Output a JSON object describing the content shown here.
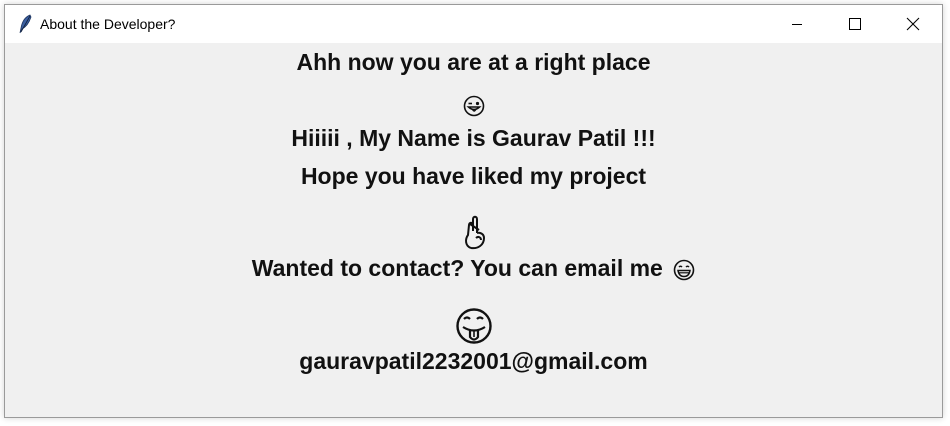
{
  "window": {
    "title": "About the Developer?",
    "controls": [
      "minimize",
      "maximize",
      "close"
    ]
  },
  "messages": {
    "line1": "Ahh now you are at a right place",
    "line2": "Hiiiii , My Name is Gaurav Patil !!!",
    "line3": "Hope you have liked my project",
    "line4": "Wanted to contact? You can email me",
    "email": "gauravpatil2232001@gmail.com"
  },
  "icons": {
    "emoji1": "tongue-out-winking-face-icon",
    "emoji2": "crossed-fingers-icon",
    "emoji3": "grinning-face-icon",
    "emoji4": "tongue-out-face-icon"
  }
}
